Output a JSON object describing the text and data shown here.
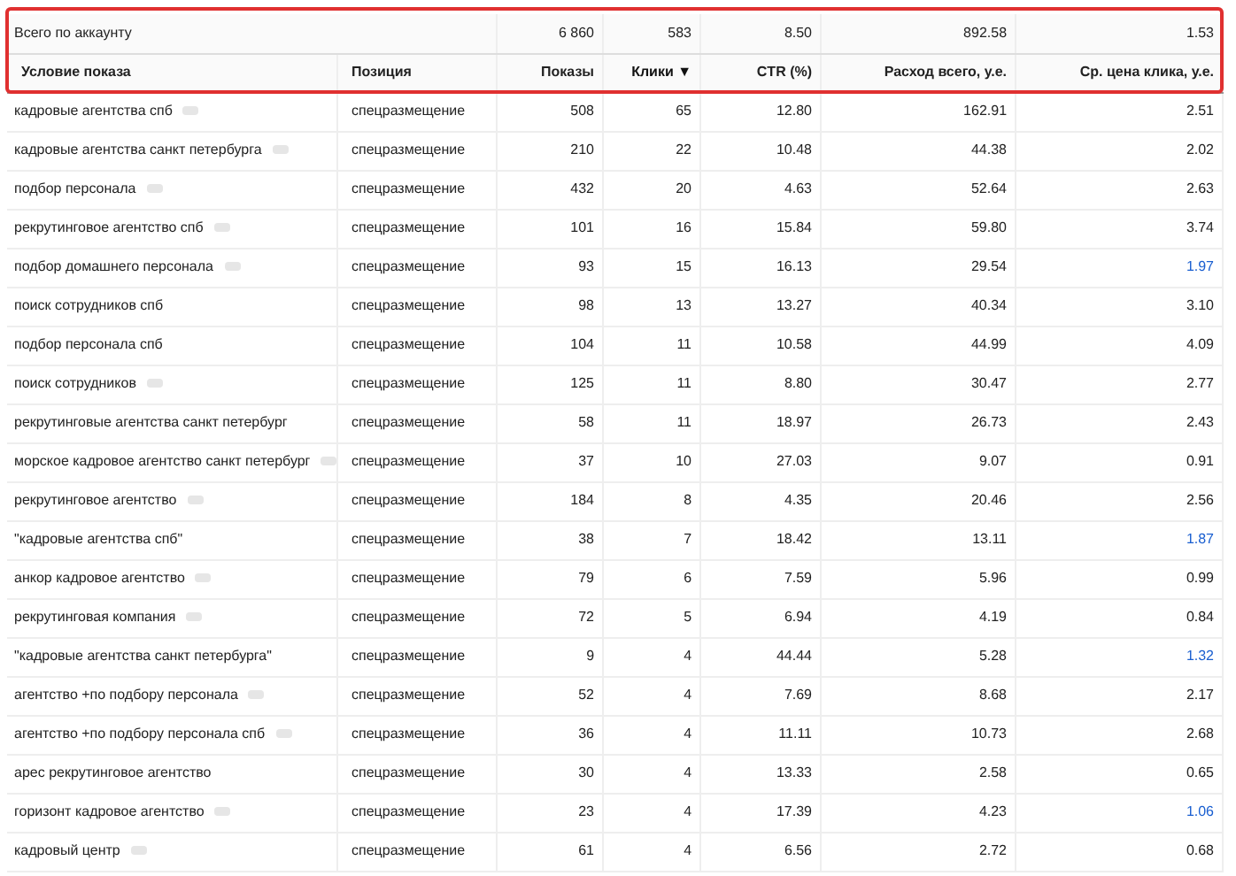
{
  "total": {
    "label": "Всего по аккаунту",
    "values": [
      "6 860",
      "583",
      "8.50",
      "892.58",
      "1.53"
    ]
  },
  "columns": [
    {
      "label": "Условие показа",
      "sorted": false
    },
    {
      "label": "Позиция",
      "sorted": false
    },
    {
      "label": "Показы",
      "sorted": false
    },
    {
      "label": "Клики",
      "sorted": true,
      "sort_mark": "▼"
    },
    {
      "label": "CTR (%)",
      "sorted": false
    },
    {
      "label": "Расход всего, у.е.",
      "sorted": false
    },
    {
      "label": "Ср. цена клика, у.е.",
      "sorted": false
    }
  ],
  "rows": [
    {
      "condition": "кадровые агентства спб",
      "has_menu": true,
      "position": "спецразмещение",
      "shows": "508",
      "clicks": "65",
      "ctr": "12.80",
      "cost": "162.91",
      "cpc": "2.51",
      "cpc_highlighted": false
    },
    {
      "condition": "кадровые агентства санкт петербурга",
      "has_menu": true,
      "position": "спецразмещение",
      "shows": "210",
      "clicks": "22",
      "ctr": "10.48",
      "cost": "44.38",
      "cpc": "2.02",
      "cpc_highlighted": false
    },
    {
      "condition": "подбор персонала",
      "has_menu": true,
      "position": "спецразмещение",
      "shows": "432",
      "clicks": "20",
      "ctr": "4.63",
      "cost": "52.64",
      "cpc": "2.63",
      "cpc_highlighted": false
    },
    {
      "condition": "рекрутинговое агентство спб",
      "has_menu": true,
      "position": "спецразмещение",
      "shows": "101",
      "clicks": "16",
      "ctr": "15.84",
      "cost": "59.80",
      "cpc": "3.74",
      "cpc_highlighted": false
    },
    {
      "condition": "подбор домашнего персонала",
      "has_menu": true,
      "position": "спецразмещение",
      "shows": "93",
      "clicks": "15",
      "ctr": "16.13",
      "cost": "29.54",
      "cpc": "1.97",
      "cpc_highlighted": true
    },
    {
      "condition": "поиск сотрудников спб",
      "has_menu": false,
      "position": "спецразмещение",
      "shows": "98",
      "clicks": "13",
      "ctr": "13.27",
      "cost": "40.34",
      "cpc": "3.10",
      "cpc_highlighted": false
    },
    {
      "condition": "подбор персонала спб",
      "has_menu": false,
      "position": "спецразмещение",
      "shows": "104",
      "clicks": "11",
      "ctr": "10.58",
      "cost": "44.99",
      "cpc": "4.09",
      "cpc_highlighted": false
    },
    {
      "condition": "поиск сотрудников",
      "has_menu": true,
      "position": "спецразмещение",
      "shows": "125",
      "clicks": "11",
      "ctr": "8.80",
      "cost": "30.47",
      "cpc": "2.77",
      "cpc_highlighted": false
    },
    {
      "condition": "рекрутинговые агентства санкт петербург",
      "has_menu": false,
      "position": "спецразмещение",
      "shows": "58",
      "clicks": "11",
      "ctr": "18.97",
      "cost": "26.73",
      "cpc": "2.43",
      "cpc_highlighted": false
    },
    {
      "condition": "морское кадровое агентство санкт петербург",
      "has_menu": true,
      "position": "спецразмещение",
      "shows": "37",
      "clicks": "10",
      "ctr": "27.03",
      "cost": "9.07",
      "cpc": "0.91",
      "cpc_highlighted": false
    },
    {
      "condition": "рекрутинговое агентство",
      "has_menu": true,
      "position": "спецразмещение",
      "shows": "184",
      "clicks": "8",
      "ctr": "4.35",
      "cost": "20.46",
      "cpc": "2.56",
      "cpc_highlighted": false
    },
    {
      "condition": "\"кадровые агентства спб\"",
      "has_menu": false,
      "position": "спецразмещение",
      "shows": "38",
      "clicks": "7",
      "ctr": "18.42",
      "cost": "13.11",
      "cpc": "1.87",
      "cpc_highlighted": true
    },
    {
      "condition": "анкор кадровое агентство",
      "has_menu": true,
      "position": "спецразмещение",
      "shows": "79",
      "clicks": "6",
      "ctr": "7.59",
      "cost": "5.96",
      "cpc": "0.99",
      "cpc_highlighted": false
    },
    {
      "condition": "рекрутинговая компания",
      "has_menu": true,
      "position": "спецразмещение",
      "shows": "72",
      "clicks": "5",
      "ctr": "6.94",
      "cost": "4.19",
      "cpc": "0.84",
      "cpc_highlighted": false
    },
    {
      "condition": "\"кадровые агентства санкт петербурга\"",
      "has_menu": false,
      "position": "спецразмещение",
      "shows": "9",
      "clicks": "4",
      "ctr": "44.44",
      "cost": "5.28",
      "cpc": "1.32",
      "cpc_highlighted": true
    },
    {
      "condition": "агентство +по подбору персонала",
      "has_menu": true,
      "position": "спецразмещение",
      "shows": "52",
      "clicks": "4",
      "ctr": "7.69",
      "cost": "8.68",
      "cpc": "2.17",
      "cpc_highlighted": false
    },
    {
      "condition": "агентство +по подбору персонала спб",
      "has_menu": true,
      "position": "спецразмещение",
      "shows": "36",
      "clicks": "4",
      "ctr": "11.11",
      "cost": "10.73",
      "cpc": "2.68",
      "cpc_highlighted": false
    },
    {
      "condition": "арес рекрутинговое агентство",
      "has_menu": false,
      "position": "спецразмещение",
      "shows": "30",
      "clicks": "4",
      "ctr": "13.33",
      "cost": "2.58",
      "cpc": "0.65",
      "cpc_highlighted": false
    },
    {
      "condition": "горизонт кадровое агентство",
      "has_menu": true,
      "position": "спецразмещение",
      "shows": "23",
      "clicks": "4",
      "ctr": "17.39",
      "cost": "4.23",
      "cpc": "1.06",
      "cpc_highlighted": true
    },
    {
      "condition": "кадровый центр",
      "has_menu": true,
      "position": "спецразмещение",
      "shows": "61",
      "clicks": "4",
      "ctr": "6.56",
      "cost": "2.72",
      "cpc": "0.68",
      "cpc_highlighted": false
    }
  ]
}
